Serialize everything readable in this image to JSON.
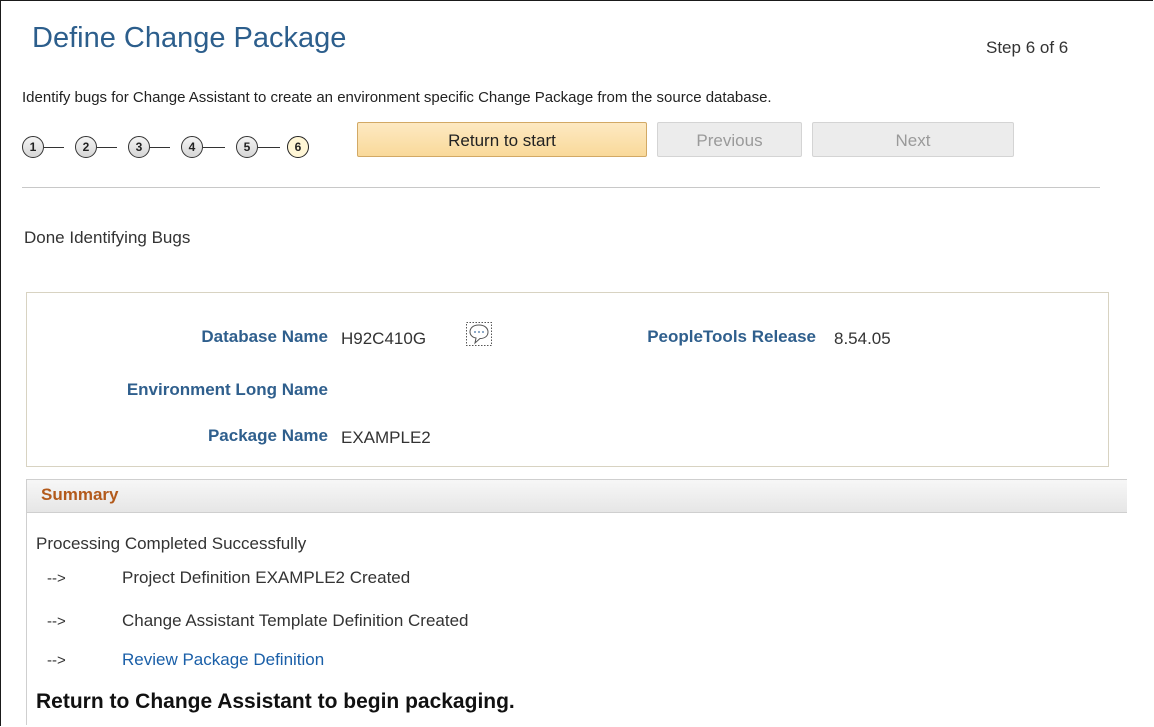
{
  "header": {
    "title": "Define Change Package",
    "step_label": "Step 6 of 6",
    "instructions": "Identify bugs for Change Assistant to create an environment specific Change Package from the source database."
  },
  "steps": [
    "1",
    "2",
    "3",
    "4",
    "5",
    "6"
  ],
  "current_step": 6,
  "buttons": {
    "return_label": "Return to start",
    "previous_label": "Previous",
    "next_label": "Next",
    "previous_enabled": false,
    "next_enabled": false
  },
  "status_text": "Done Identifying Bugs",
  "details": {
    "database_name_label": "Database Name",
    "database_name_value": "H92C410G",
    "peopletools_label": "PeopleTools Release",
    "peopletools_value": "8.54.05",
    "env_long_name_label": "Environment Long Name",
    "env_long_name_value": "",
    "package_name_label": "Package Name",
    "package_name_value": "EXAMPLE2",
    "chat_icon": "chat-bubble-icon"
  },
  "summary": {
    "title": "Summary",
    "processing_text": "Processing Completed Successfully",
    "arrow": "-->",
    "line1": "Project Definition EXAMPLE2 Created",
    "line2": "Change Assistant Template Definition Created",
    "link": "Review Package Definition",
    "final_message": "Return to Change Assistant to begin packaging."
  },
  "colors": {
    "title": "#2c5e8c",
    "label": "#2f5f8d",
    "summary_title": "#b35a1b",
    "link": "#1a5fa8",
    "primary_button": "#f9d99a"
  }
}
